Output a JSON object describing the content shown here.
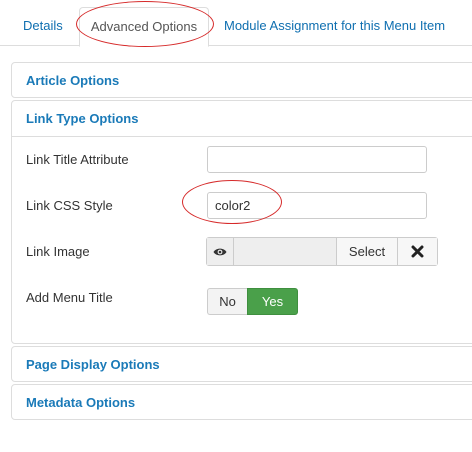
{
  "tabs": [
    {
      "label": "Details"
    },
    {
      "label": "Advanced Options"
    },
    {
      "label": "Module Assignment for this Menu Item"
    }
  ],
  "panels": {
    "article": {
      "title": "Article Options"
    },
    "link_type": {
      "title": "Link Type Options",
      "fields": {
        "link_title": {
          "label": "Link Title Attribute",
          "value": ""
        },
        "link_css": {
          "label": "Link CSS Style",
          "value": "color2"
        },
        "link_image": {
          "label": "Link Image",
          "select_label": "Select",
          "preview_icon": "eye-icon",
          "clear_icon": "close-icon"
        },
        "menu_title": {
          "label": "Add Menu Title",
          "no_label": "No",
          "yes_label": "Yes",
          "selected": "Yes"
        }
      }
    },
    "page_display": {
      "title": "Page Display Options"
    },
    "metadata": {
      "title": "Metadata Options"
    }
  },
  "colors": {
    "link": "#1a7ab8",
    "annotation": "#d62a2a",
    "yes_active": "#4aa04a"
  }
}
